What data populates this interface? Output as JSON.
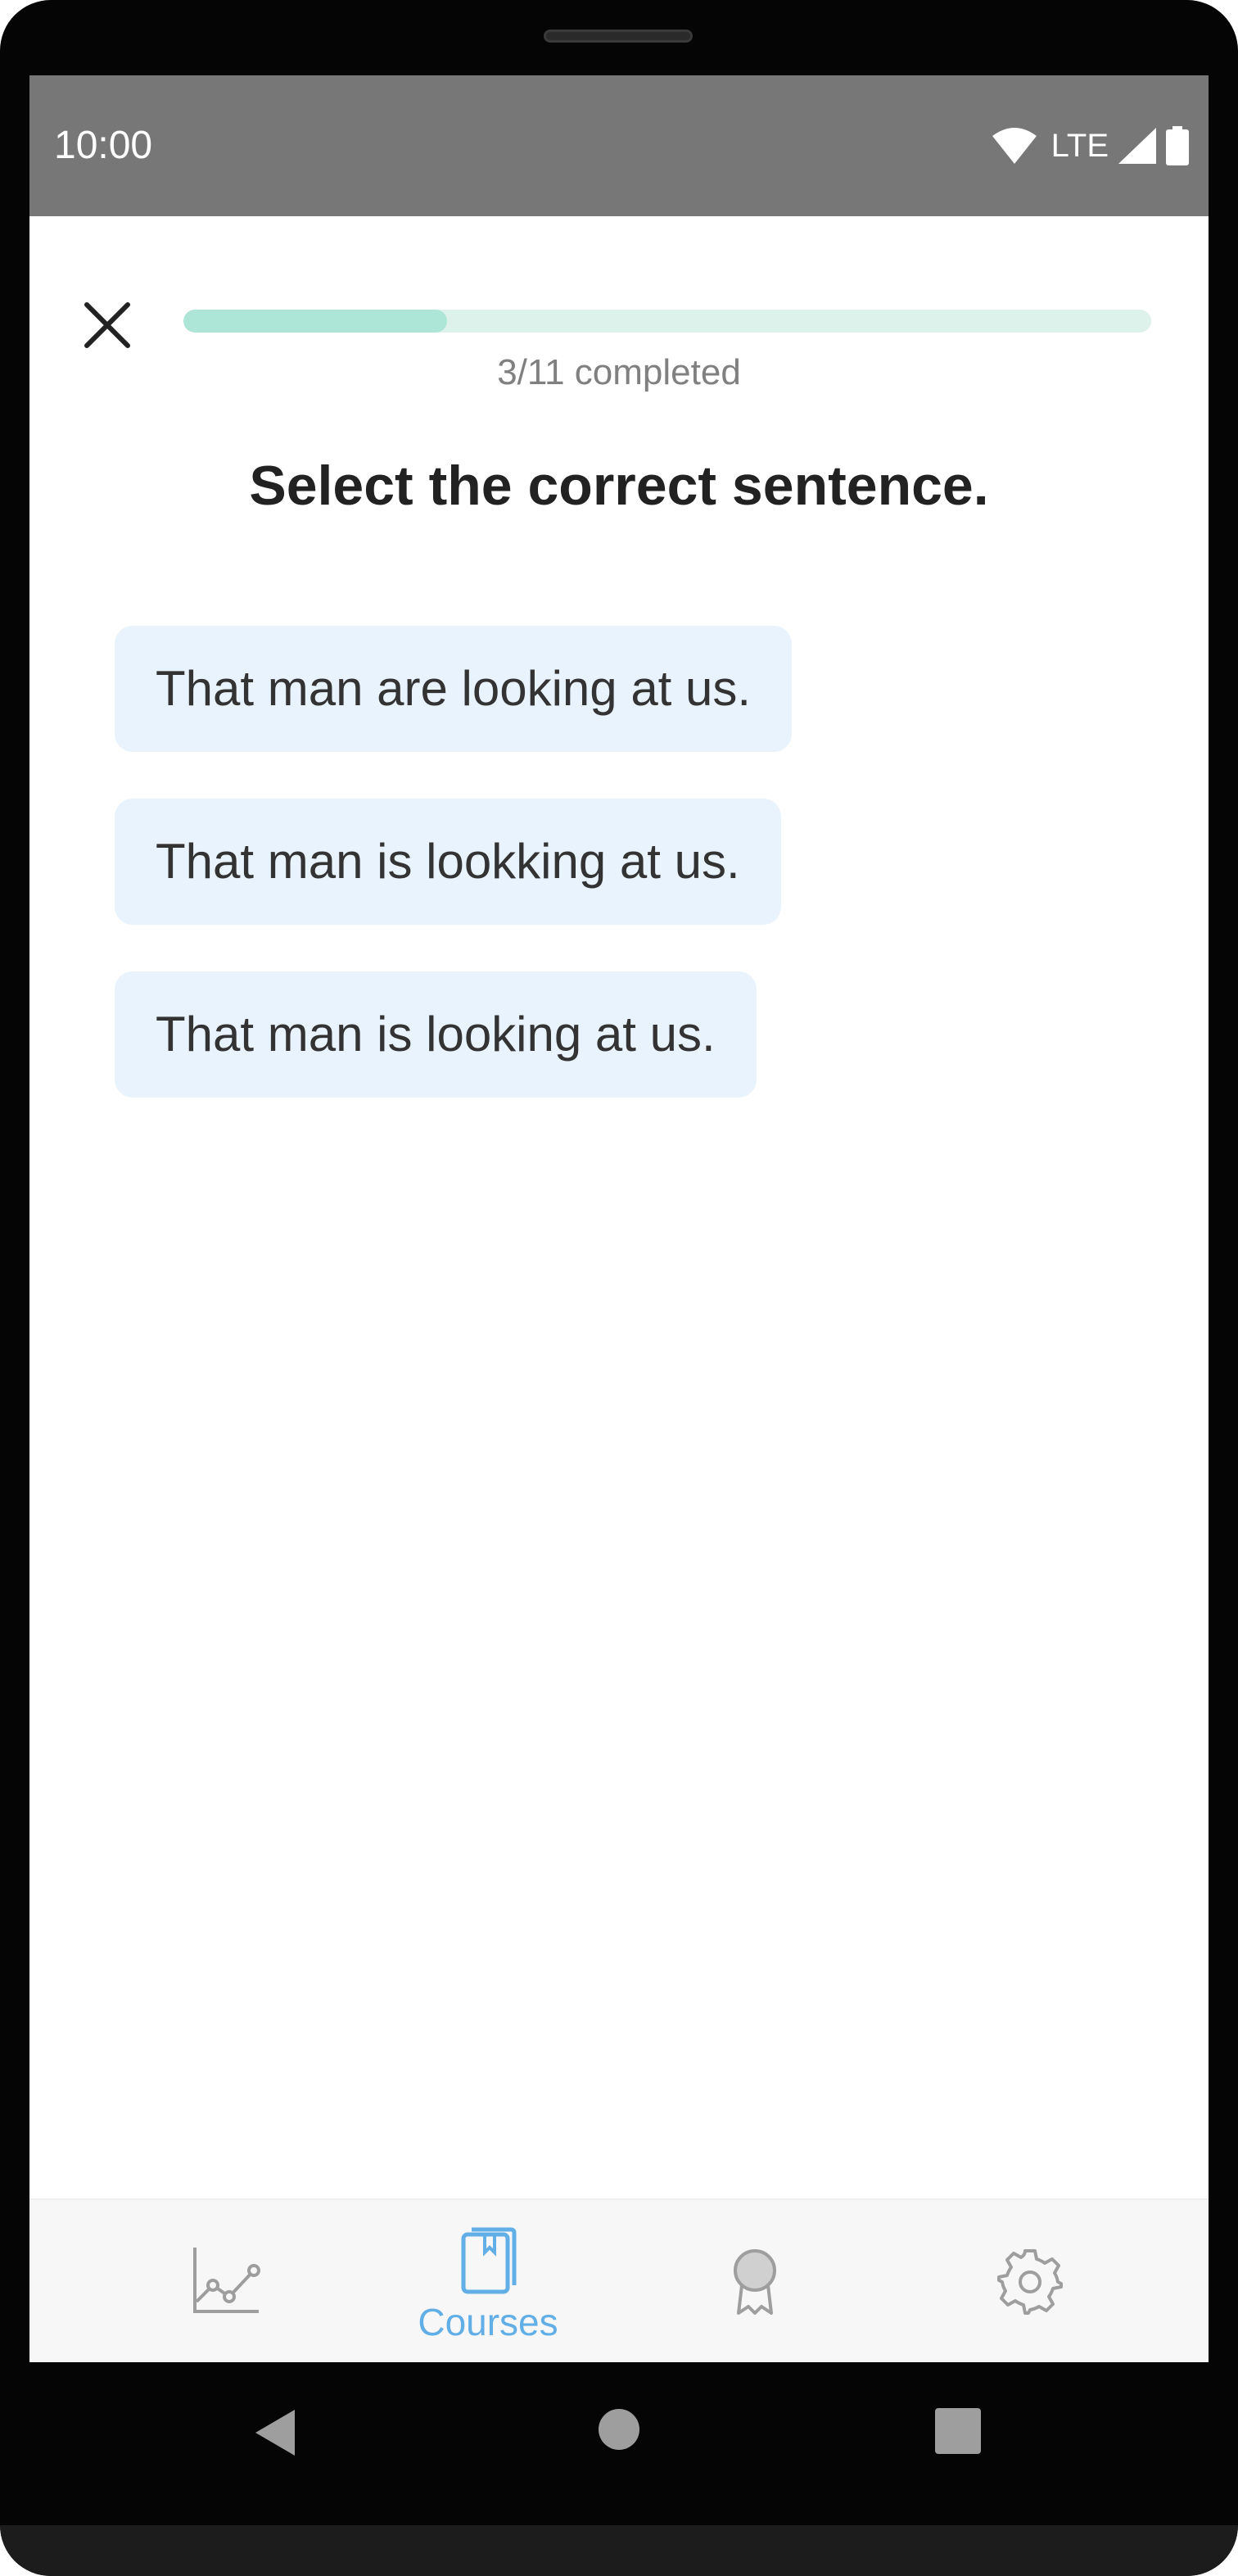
{
  "status_bar": {
    "time": "10:00",
    "network": "LTE"
  },
  "lesson": {
    "progress_completed": 3,
    "progress_total": 11,
    "progress_text": "3/11 completed",
    "question": "Select the correct sentence.",
    "options": [
      "That man are looking at us.",
      "That man is lookking at us.",
      "That man is looking at us."
    ]
  },
  "bottom_nav": {
    "items": [
      {
        "icon": "chart-line-icon",
        "label": ""
      },
      {
        "icon": "book-icon",
        "label": "Courses"
      },
      {
        "icon": "award-icon",
        "label": ""
      },
      {
        "icon": "gear-icon",
        "label": ""
      }
    ],
    "active_index": 1
  },
  "colors": {
    "status_bar_bg": "#777777",
    "progress_track": "#def2ec",
    "progress_fill": "#ade6d6",
    "option_bg": "#e8f3fd",
    "accent": "#62aee6",
    "inactive_icon": "#9e9e9e"
  }
}
